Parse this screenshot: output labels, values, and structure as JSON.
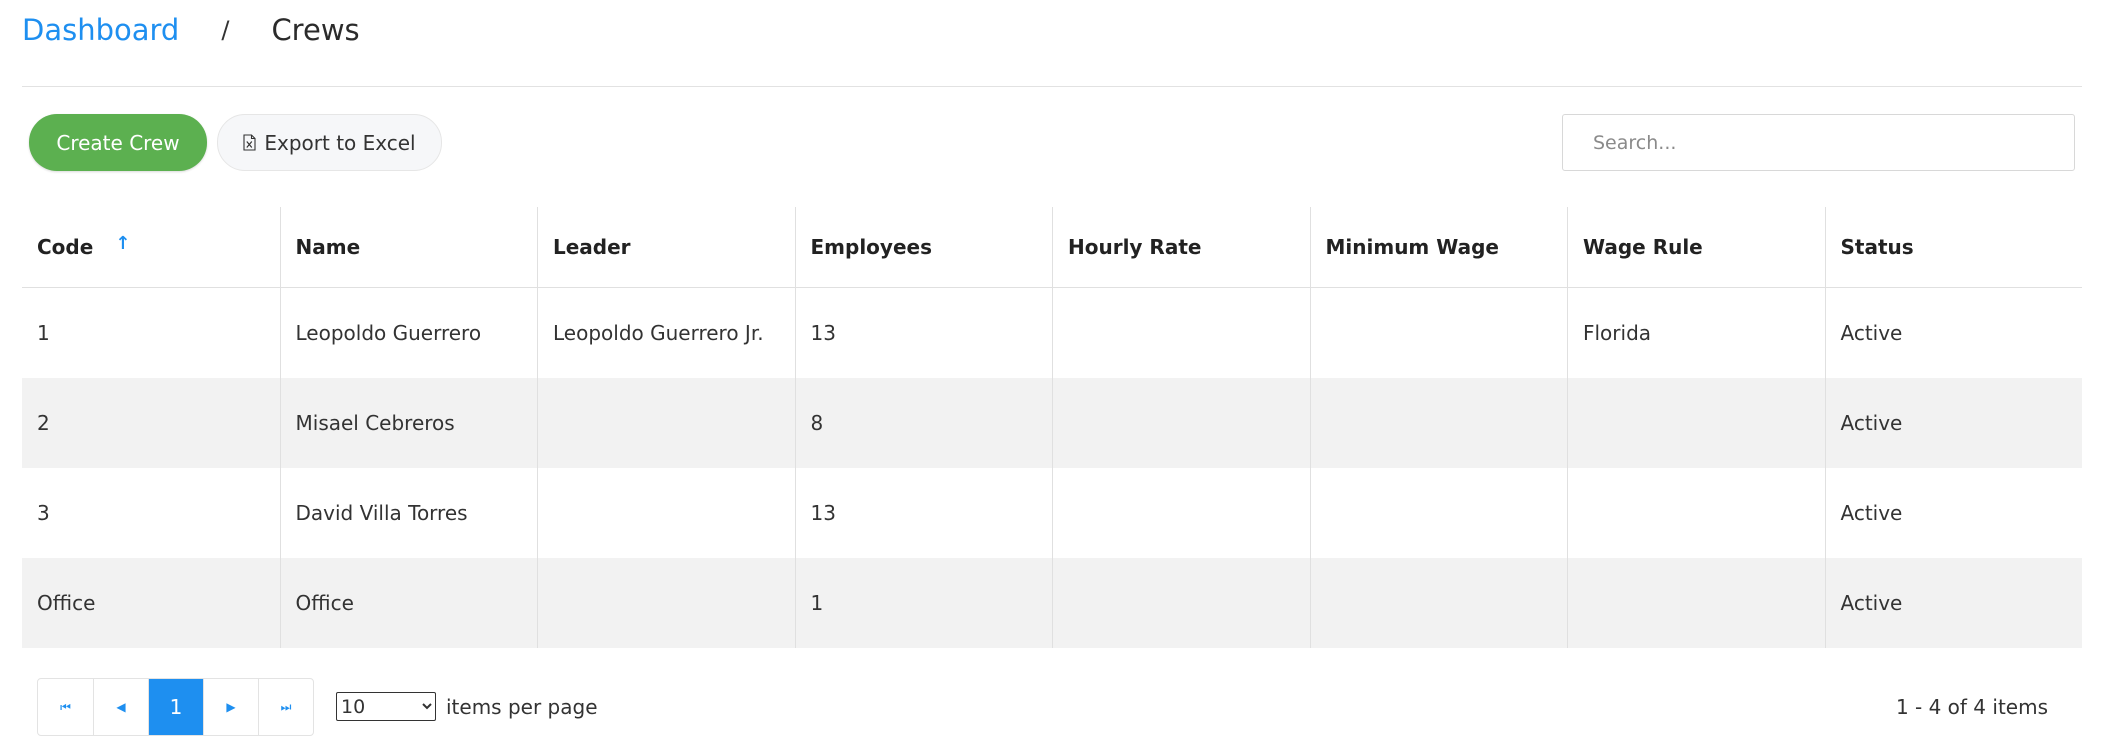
{
  "breadcrumb": {
    "home": "Dashboard",
    "separator": "/",
    "current": "Crews"
  },
  "toolbar": {
    "create_label": "Create Crew",
    "export_label": "Export to Excel",
    "search_placeholder": "Search..."
  },
  "table": {
    "columns": [
      "Code",
      "Name",
      "Leader",
      "Employees",
      "Hourly Rate",
      "Minimum Wage",
      "Wage Rule",
      "Status"
    ],
    "sort": {
      "column": "Code",
      "direction": "ascending",
      "icon": "↑"
    },
    "rows": [
      [
        "1",
        "Leopoldo Guerrero",
        "Leopoldo Guerrero Jr.",
        "13",
        "",
        "",
        "Florida",
        "Active"
      ],
      [
        "2",
        "Misael Cebreros",
        "",
        "8",
        "",
        "",
        "",
        "Active"
      ],
      [
        "3",
        "David Villa Torres",
        "",
        "13",
        "",
        "",
        "",
        "Active"
      ],
      [
        "Office",
        "Office",
        "",
        "1",
        "",
        "",
        "",
        "Active"
      ]
    ]
  },
  "pager": {
    "first_icon": "⏮",
    "prev_icon": "◀",
    "current_page": "1",
    "next_icon": "▶",
    "last_icon": "⏭",
    "page_size": "10",
    "page_size_options": [
      "10"
    ],
    "items_per_page_label": "items per page",
    "summary": "1 - 4 of 4 items"
  },
  "colors": {
    "accent": "#1e8ff0",
    "primary_button": "#5cb050",
    "alt_row": "#f2f2f2"
  }
}
